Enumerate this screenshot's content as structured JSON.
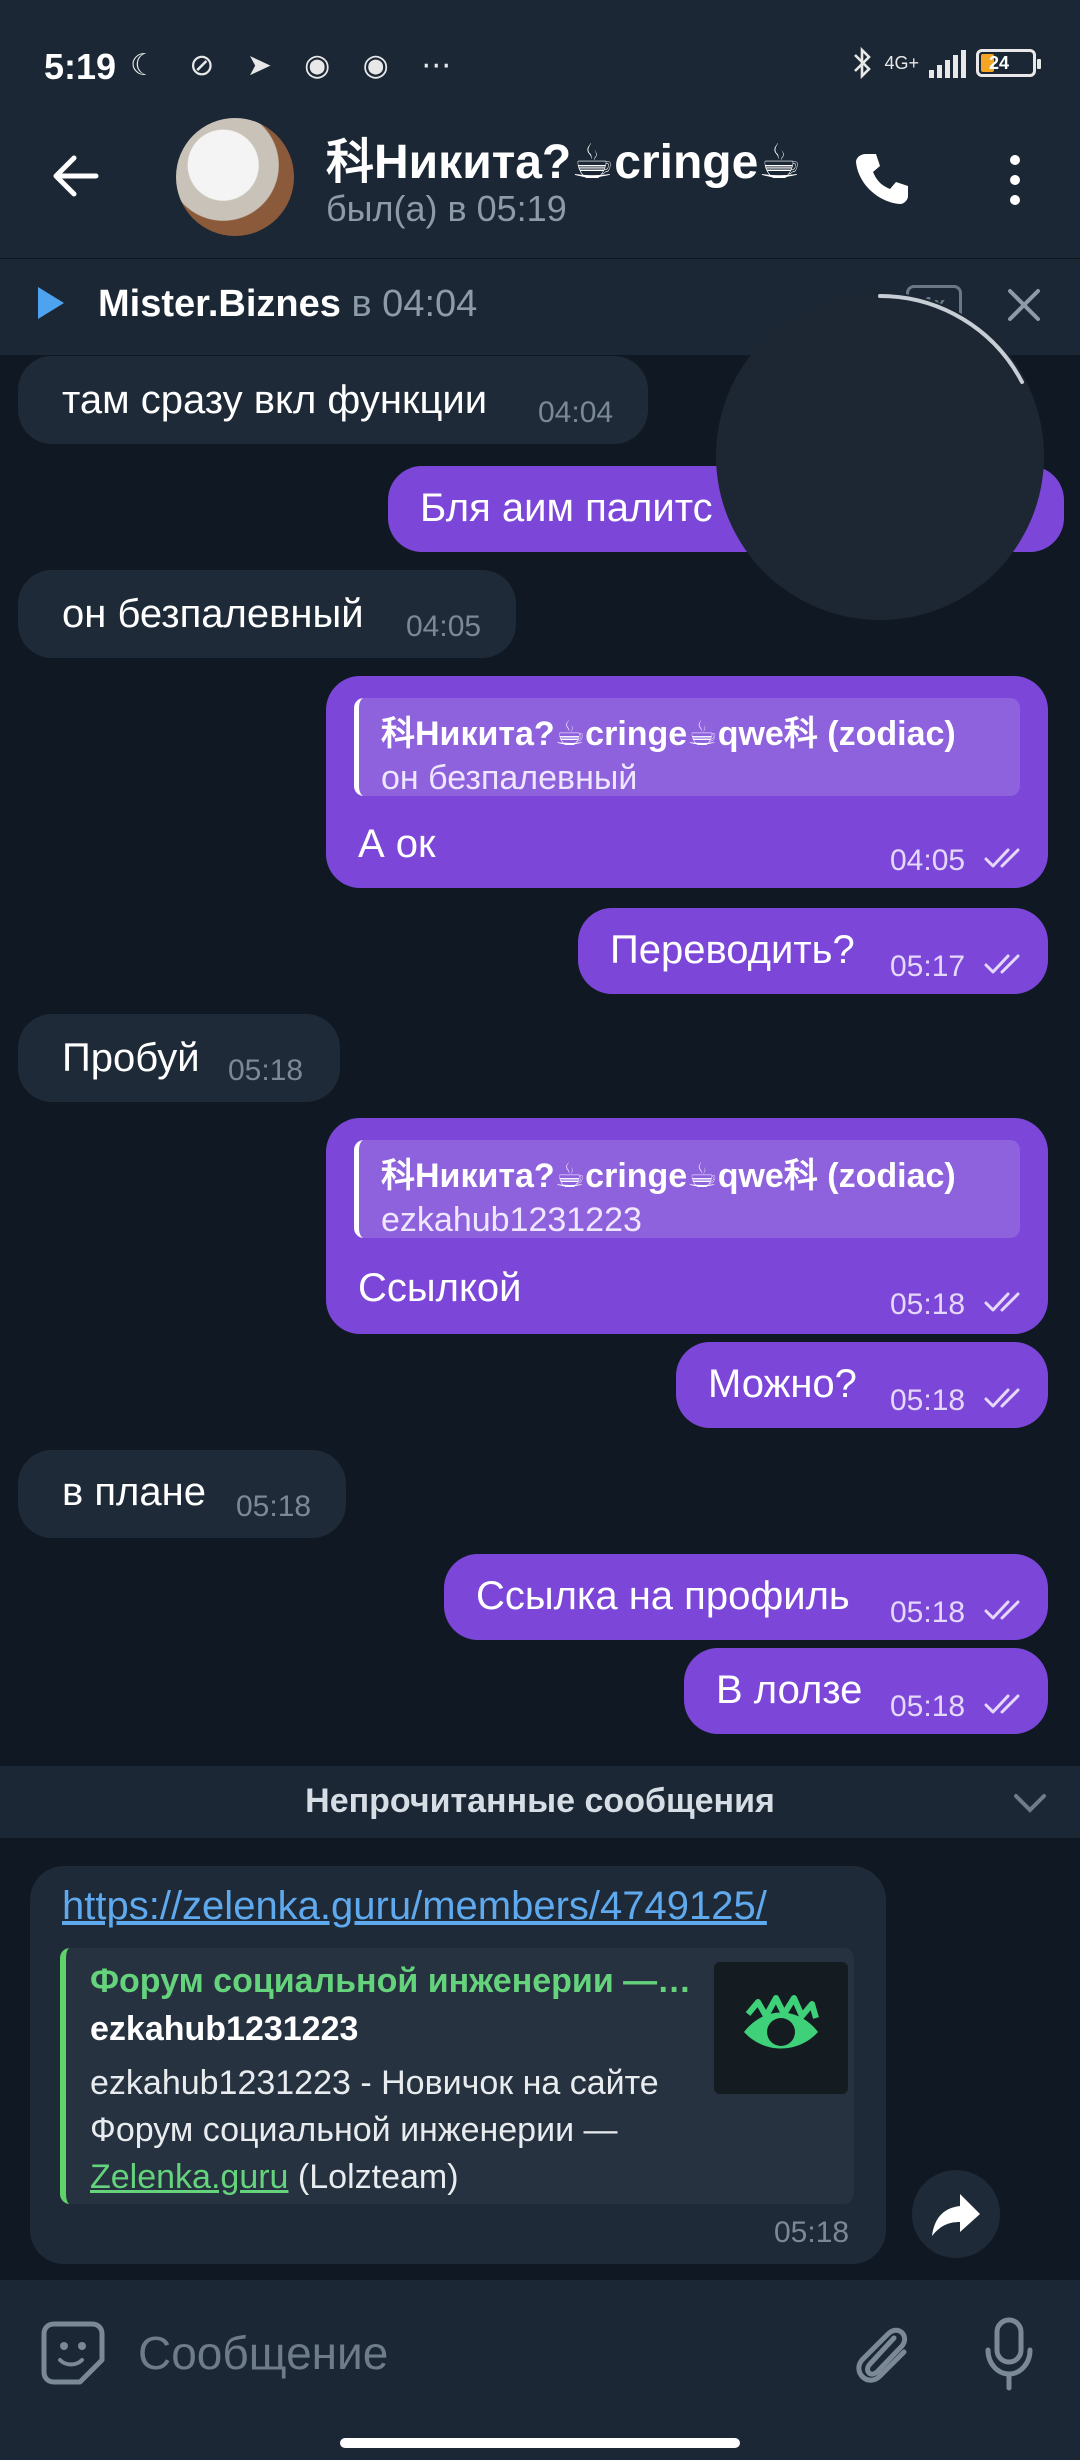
{
  "status": {
    "time": "5:19",
    "network": "4G+",
    "battery": "24"
  },
  "header": {
    "title": "科Никита?☕cringe☕",
    "subtitle": "был(а) в 05:19"
  },
  "pinned": {
    "name": "Mister.Biznes",
    "time_text": "в 04:04"
  },
  "messages": [
    {
      "text": "там сразу вкл функции",
      "time": "04:04"
    },
    {
      "text": "Бля аим палитс"
    },
    {
      "text": "он безпалевный",
      "time": "04:05"
    },
    {
      "reply_name": "科Никита?☕cringe☕qwe科 (zodiac)",
      "reply_text": "он безпалевный",
      "text": "А ок",
      "time": "04:05"
    },
    {
      "text": "Переводить?",
      "time": "05:17"
    },
    {
      "text": "Пробуй",
      "time": "05:18"
    },
    {
      "reply_name": "科Никита?☕cringe☕qwe科 (zodiac)",
      "reply_text": "ezkahub1231223",
      "text": "Ссылкой",
      "time": "05:18"
    },
    {
      "text": "Можно?",
      "time": "05:18"
    },
    {
      "text": "в плане",
      "time": "05:18"
    },
    {
      "text": "Ссылка на профиль",
      "time": "05:18"
    },
    {
      "text": "В лолзе",
      "time": "05:18"
    }
  ],
  "unread_label": "Непрочитанные сообщения",
  "link_message": {
    "url": "https://zelenka.guru/members/4749125/",
    "preview_site": "Форум социальной инженерии —…",
    "preview_title": "ezkahub1231223",
    "preview_desc_pre": "ezkahub1231223 - Новичок на сайте Форум социальной инженерии —",
    "preview_desc_link": "Zelenka.guru",
    "preview_desc_post": "(Lolzteam)",
    "time": "05:18"
  },
  "input": {
    "placeholder": "Сообщение"
  },
  "colors": {
    "background": "#101923",
    "bar": "#1b2735",
    "incoming": "#1e2a37",
    "outgoing": "#7c47d8",
    "link": "#5fa9ef",
    "preview_accent": "#5fd26a"
  }
}
